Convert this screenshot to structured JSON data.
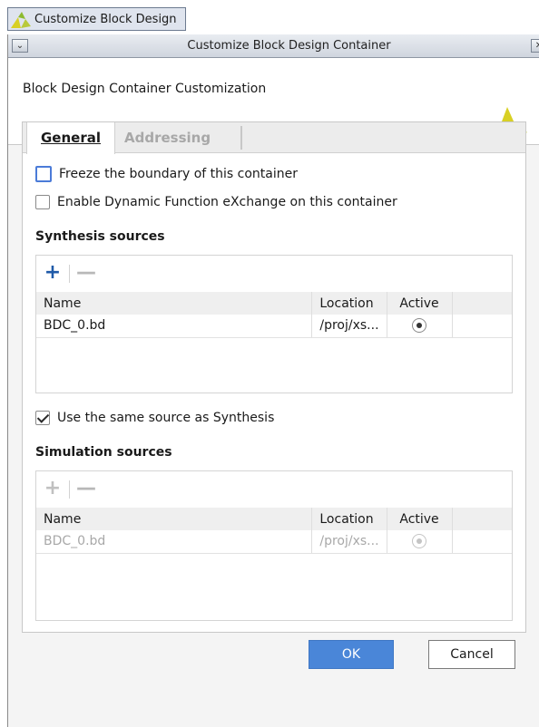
{
  "taskbar": {
    "label": "Customize Block Design"
  },
  "window": {
    "title": "Customize Block Design Container",
    "menu_glyph": "⌄",
    "close_glyph": "✕"
  },
  "header": {
    "heading": "Block Design Container Customization"
  },
  "tabs": [
    {
      "label": "General",
      "active": true
    },
    {
      "label": "Addressing",
      "active": false
    }
  ],
  "options": {
    "freeze_label": "Freeze the boundary of this container",
    "freeze_checked": false,
    "dfx_label": "Enable Dynamic Function eXchange on this container",
    "dfx_checked": false,
    "same_source_label": "Use the same source as Synthesis",
    "same_source_checked": true
  },
  "synthesis": {
    "title": "Synthesis sources",
    "add_glyph": "+",
    "remove_glyph": "—",
    "columns": [
      "Name",
      "Location",
      "Active"
    ],
    "rows": [
      {
        "name": "BDC_0.bd",
        "location": "/proj/xs...",
        "active": true
      }
    ]
  },
  "simulation": {
    "title": "Simulation sources",
    "add_glyph": "+",
    "remove_glyph": "—",
    "columns": [
      "Name",
      "Location",
      "Active"
    ],
    "rows": [
      {
        "name": "BDC_0.bd",
        "location": "/proj/xs...",
        "active": true
      }
    ]
  },
  "buttons": {
    "ok": "OK",
    "cancel": "Cancel"
  },
  "colors": {
    "accent": "#4a86d8",
    "brand_green": "#8dba2f",
    "brand_yellow": "#d8d024"
  }
}
